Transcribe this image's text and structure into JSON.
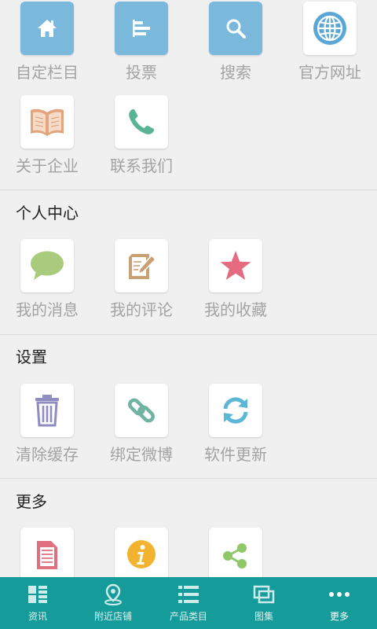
{
  "row1": [
    {
      "label": "自定栏目",
      "icon": "home-icon"
    },
    {
      "label": "投票",
      "icon": "poll-icon"
    },
    {
      "label": "搜索",
      "icon": "search-icon"
    },
    {
      "label": "官方网址",
      "icon": "globe-icon"
    }
  ],
  "row2": [
    {
      "label": "关于企业",
      "icon": "book-icon"
    },
    {
      "label": "联系我们",
      "icon": "phone-icon"
    }
  ],
  "personal": {
    "title": "个人中心",
    "items": [
      {
        "label": "我的消息",
        "icon": "speech-bubble-icon"
      },
      {
        "label": "我的评论",
        "icon": "edit-note-icon"
      },
      {
        "label": "我的收藏",
        "icon": "star-icon"
      }
    ]
  },
  "settings": {
    "title": "设置",
    "items": [
      {
        "label": "清除缓存",
        "icon": "trash-icon"
      },
      {
        "label": "绑定微博",
        "icon": "link-icon"
      },
      {
        "label": "软件更新",
        "icon": "refresh-icon"
      }
    ]
  },
  "more": {
    "title": "更多",
    "items": [
      {
        "label": "",
        "icon": "document-icon"
      },
      {
        "label": "",
        "icon": "info-icon"
      },
      {
        "label": "",
        "icon": "share-icon"
      }
    ]
  },
  "tabbar": [
    {
      "label": "资讯",
      "icon": "grid-icon"
    },
    {
      "label": "附近店铺",
      "icon": "location-pin-icon"
    },
    {
      "label": "产品类目",
      "icon": "list-icon"
    },
    {
      "label": "图集",
      "icon": "gallery-icon"
    },
    {
      "label": "更多",
      "icon": "more-dots-icon",
      "active": true
    }
  ],
  "colors": {
    "tabbar_bg": "#159c9a",
    "tile_blue": "#7ab8dc",
    "page_bg": "#f0f0f0"
  }
}
